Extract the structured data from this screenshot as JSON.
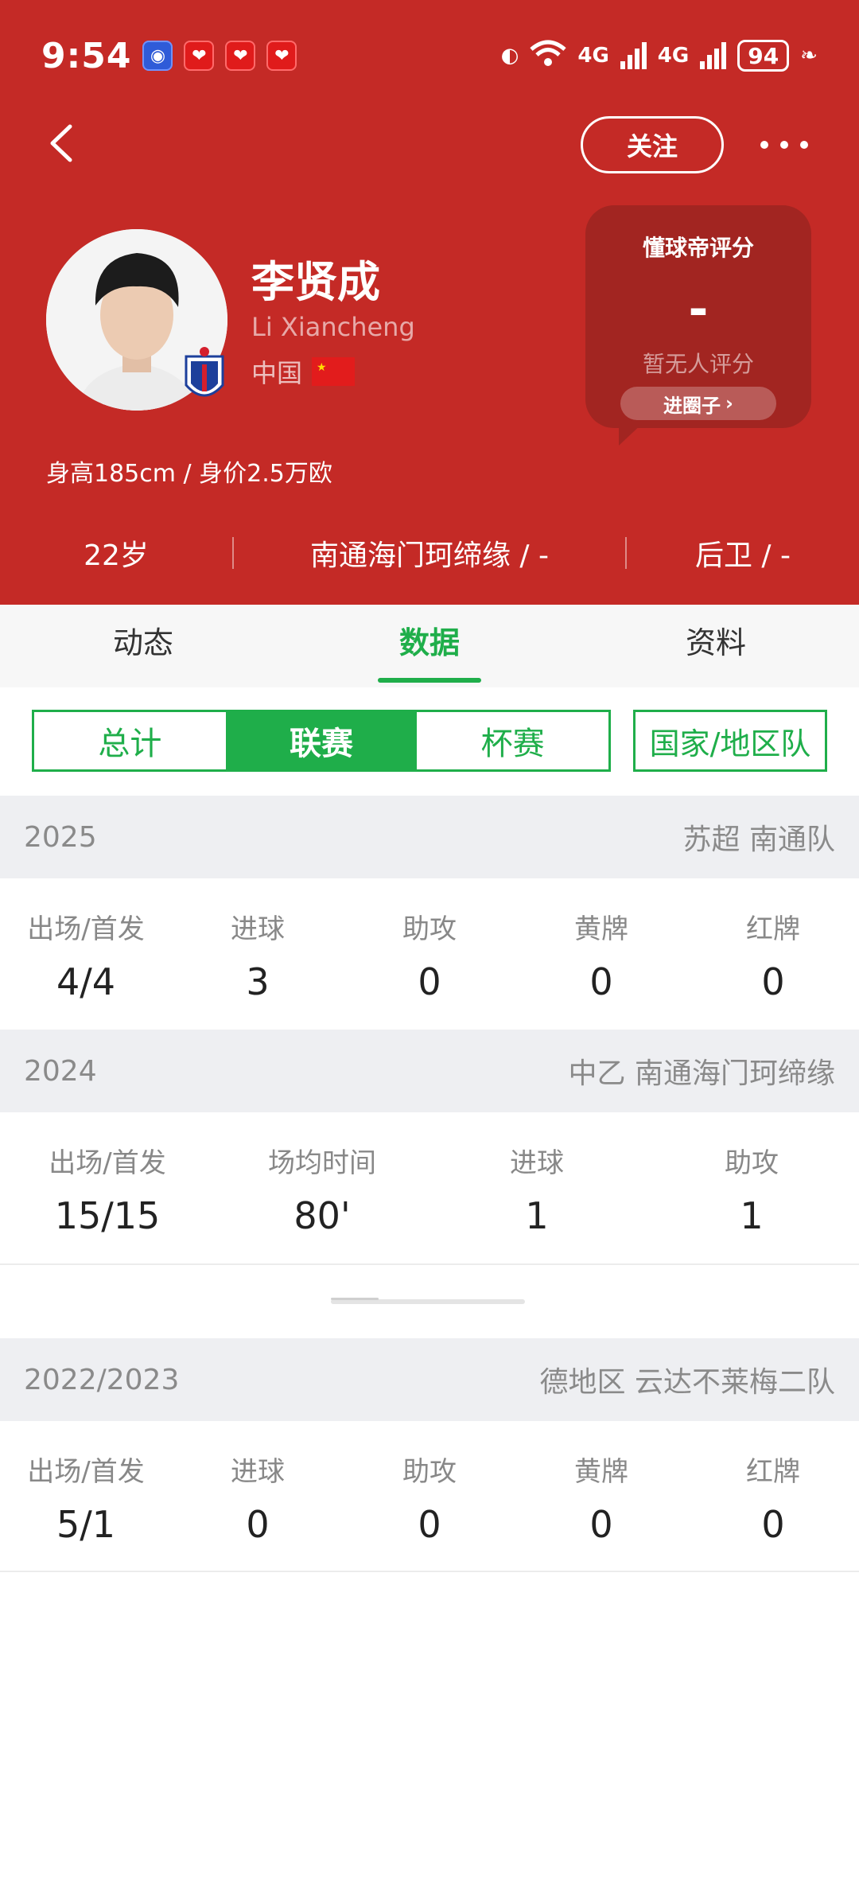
{
  "status_bar": {
    "time": "9:54",
    "network": "4G",
    "network2": "4G",
    "battery": "94"
  },
  "header": {
    "follow_label": "关注",
    "player_name": "李贤成",
    "player_name_en": "Li Xiancheng",
    "country": "中国",
    "height_value": "身高185cm / 身价2.5万欧",
    "rating": {
      "title": "懂球帝评分",
      "value": "-",
      "subtitle": "暂无人评分",
      "button": "进圈子"
    },
    "info": {
      "age": "22岁",
      "club": "南通海门珂缔缘 / -",
      "position": "后卫 / -"
    }
  },
  "tabs": [
    {
      "label": "动态"
    },
    {
      "label": "数据"
    },
    {
      "label": "资料"
    }
  ],
  "subtabs": [
    {
      "label": "总计"
    },
    {
      "label": "联赛"
    },
    {
      "label": "杯赛"
    }
  ],
  "national_label": "国家/地区队",
  "seasons": [
    {
      "year": "2025",
      "team": "苏超 南通队",
      "labels": [
        "出场/首发",
        "进球",
        "助攻",
        "黄牌",
        "红牌"
      ],
      "values": [
        "4/4",
        "3",
        "0",
        "0",
        "0"
      ]
    },
    {
      "year": "2024",
      "team": "中乙 南通海门珂缔缘",
      "labels": [
        "出场/首发",
        "场均时间",
        "进球",
        "助攻"
      ],
      "values": [
        "15/15",
        "80'",
        "1",
        "1"
      ]
    },
    {
      "year": "2022/2023",
      "team": "德地区 云达不莱梅二队",
      "labels": [
        "出场/首发",
        "进球",
        "助攻",
        "黄牌",
        "红牌"
      ],
      "values": [
        "5/1",
        "0",
        "0",
        "0",
        "0"
      ]
    }
  ],
  "colors": {
    "header_red": "#c42a26",
    "accent_green": "#1fae4a"
  }
}
